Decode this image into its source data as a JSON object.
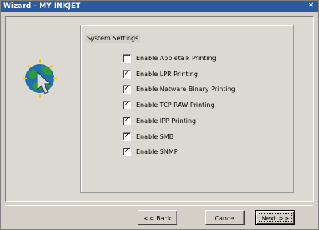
{
  "window": {
    "title": "Wizard - MY INKJET",
    "close_glyph": "×"
  },
  "settings_group": {
    "legend": "System Settings",
    "options": [
      {
        "label": "Enable Appletalk Printing",
        "checked": false
      },
      {
        "label": "Enable LPR Printing",
        "checked": true
      },
      {
        "label": "Enable Netware Binary Printing",
        "checked": true
      },
      {
        "label": "Enable TCP RAW Printing",
        "checked": true
      },
      {
        "label": "Enable IPP Printing",
        "checked": true
      },
      {
        "label": "Enable SMB",
        "checked": true
      },
      {
        "label": "Enable SNMP",
        "checked": true
      }
    ]
  },
  "buttons": {
    "back": "<< Back",
    "cancel": "Cancel",
    "next": "Next >>"
  },
  "icons": {
    "wizard": "globe-with-cursor-icon"
  },
  "colors": {
    "titlebar": "#2a5a9f",
    "face": "#d4d0c8"
  }
}
